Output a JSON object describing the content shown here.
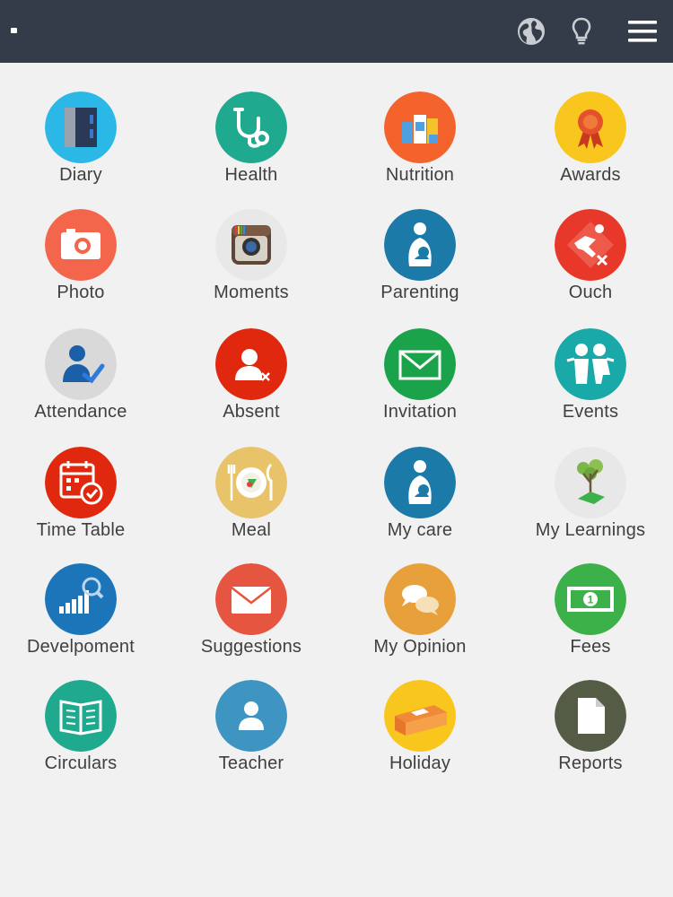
{
  "topbar": {
    "icons": [
      "back-icon",
      "globe-icon",
      "bulb-icon",
      "menu-icon"
    ]
  },
  "items": [
    {
      "label": "Diary",
      "icon": "diary-icon",
      "color": "#2cb8e6"
    },
    {
      "label": "Health",
      "icon": "stethoscope-icon",
      "color": "#1fa98e"
    },
    {
      "label": "Nutrition",
      "icon": "nutrition-icon",
      "color": "#f4632c"
    },
    {
      "label": "Awards",
      "icon": "award-icon",
      "color": "#f8c61c"
    },
    {
      "label": "Photo",
      "icon": "camera-icon",
      "color": "#f4664c"
    },
    {
      "label": "Moments",
      "icon": "instagram-icon",
      "color": "#e8e8e8"
    },
    {
      "label": "Parenting",
      "icon": "parenting-icon",
      "color": "#1c7aa8"
    },
    {
      "label": "Ouch",
      "icon": "ouch-icon",
      "color": "#e8382a"
    },
    {
      "label": "Attendance",
      "icon": "attendance-icon",
      "color": "#d9d9d9"
    },
    {
      "label": "Absent",
      "icon": "absent-icon",
      "color": "#e0280e"
    },
    {
      "label": "Invitation",
      "icon": "envelope-icon",
      "color": "#1aa34a"
    },
    {
      "label": "Events",
      "icon": "kids-icon",
      "color": "#18a9a8"
    },
    {
      "label": "Time Table",
      "icon": "calendar-icon",
      "color": "#e0280e"
    },
    {
      "label": "Meal",
      "icon": "meal-icon",
      "color": "#e8c36a"
    },
    {
      "label": "My care",
      "icon": "care-icon",
      "color": "#1c7aa8"
    },
    {
      "label": "My Learnings",
      "icon": "tree-icon",
      "color": "#e8e8e8"
    },
    {
      "label": "Develpoment",
      "icon": "chart-icon",
      "color": "#1b75b8"
    },
    {
      "label": "Suggestions",
      "icon": "mail-icon",
      "color": "#e6553f"
    },
    {
      "label": "My Opinion",
      "icon": "chat-icon",
      "color": "#e8a13a"
    },
    {
      "label": "Fees",
      "icon": "money-icon",
      "color": "#3cb14a"
    },
    {
      "label": "Circulars",
      "icon": "book-icon",
      "color": "#1fa98e"
    },
    {
      "label": "Teacher",
      "icon": "teacher-icon",
      "color": "#3e95c1"
    },
    {
      "label": "Holiday",
      "icon": "bed-icon",
      "color": "#f8c61c"
    },
    {
      "label": "Reports",
      "icon": "document-icon",
      "color": "#545c45"
    }
  ]
}
